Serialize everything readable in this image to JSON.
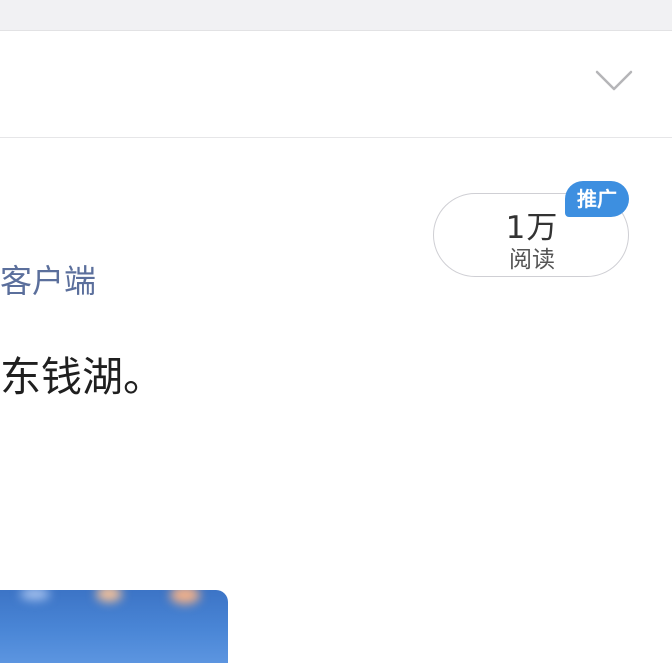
{
  "header": {
    "expand_icon": "chevron-down-icon"
  },
  "post": {
    "source": "客户端",
    "text": "东钱湖。",
    "stats": {
      "read_count": "1万",
      "read_label": "阅读",
      "promo_label": "推广"
    },
    "image": {
      "description": "photo-thumbnail"
    }
  },
  "colors": {
    "source_link": "#5b6f9c",
    "promo_badge": "#3d8fe0",
    "body_text": "#1f1f1f"
  }
}
